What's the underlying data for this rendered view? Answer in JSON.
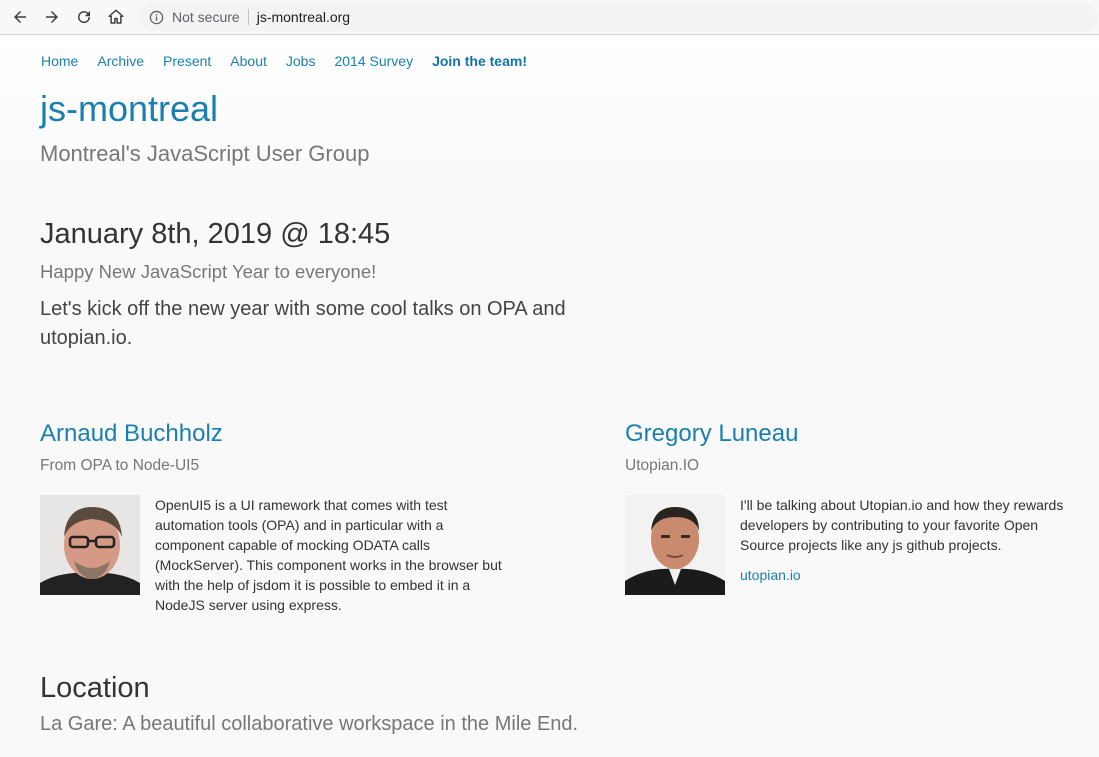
{
  "browser": {
    "security_label": "Not secure",
    "url": "js-montreal.org",
    "icons": [
      "back-arrow-icon",
      "forward-arrow-icon",
      "reload-icon",
      "home-icon",
      "info-icon"
    ]
  },
  "nav": {
    "items": [
      "Home",
      "Archive",
      "Present",
      "About",
      "Jobs",
      "2014 Survey",
      "Join the team!"
    ]
  },
  "site": {
    "title": "js-montreal",
    "subtitle": "Montreal's JavaScript User Group"
  },
  "event": {
    "date": "January 8th, 2019 @ 18:45",
    "lead": "Happy New JavaScript Year to everyone!",
    "description": "Let's kick off the new year with some cool talks on OPA and utopian.io."
  },
  "speakers": [
    {
      "name": "Arnaud Buchholz",
      "talk": "From OPA to Node-UI5",
      "bio": "OpenUI5 is a UI ramework that comes with test automation tools (OPA) and in particular with a component capable of mocking ODATA calls (MockServer). This component works in the browser but with the help of jsdom it is possible to embed it in a NodeJS server using express.",
      "link": ""
    },
    {
      "name": "Gregory Luneau",
      "talk": "Utopian.IO",
      "bio": "I'll be talking about Utopian.io and how they rewards developers by contributing to your favorite Open Source projects like any js github projects.",
      "link": "utopian.io"
    }
  ],
  "location": {
    "heading": "Location",
    "text": "La Gare: A beautiful collaborative workspace in the Mile End."
  },
  "colors": {
    "link": "#1a7fb0",
    "heading": "#333333",
    "muted": "#777777"
  }
}
